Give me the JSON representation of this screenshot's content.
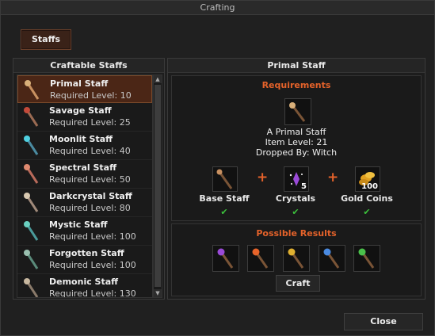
{
  "window": {
    "title": "Crafting"
  },
  "tab": {
    "label": "Staffs"
  },
  "list": {
    "header": "Craftable Staffs",
    "items": [
      {
        "name": "Primal Staff",
        "level": "Required Level: 10",
        "selected": true,
        "color": "#c89060",
        "gem": "#d9b07a"
      },
      {
        "name": "Savage Staff",
        "level": "Required Level: 25",
        "color": "#9a6a52",
        "gem": "#c44a3a"
      },
      {
        "name": "Moonlit Staff",
        "level": "Required Level: 40",
        "color": "#4a8aa0",
        "gem": "#4fd0e0"
      },
      {
        "name": "Spectral Staff",
        "level": "Required Level: 50",
        "color": "#b86a5a",
        "gem": "#e08a70"
      },
      {
        "name": "Darkcrystal Staff",
        "level": "Required Level: 80",
        "color": "#a08a7a",
        "gem": "#d8c8b0"
      },
      {
        "name": "Mystic Staff",
        "level": "Required Level: 100",
        "color": "#4a9a9a",
        "gem": "#6ad0c0"
      },
      {
        "name": "Forgotten Staff",
        "level": "Required Level: 100",
        "color": "#5a8a7a",
        "gem": "#9ac0b0"
      },
      {
        "name": "Demonic Staff",
        "level": "Required Level: 130",
        "color": "#8a7a6a",
        "gem": "#c8b8a0"
      }
    ]
  },
  "detail": {
    "header": "Primal Staff",
    "requirements_title": "Requirements",
    "item_name": "A Primal Staff",
    "item_level": "Item Level: 21",
    "dropped_by": "Dropped By: Witch",
    "components": [
      {
        "label": "Base Staff",
        "qty": "",
        "icon": "base-staff-icon"
      },
      {
        "label": "Crystals",
        "qty": "5",
        "icon": "crystals-icon"
      },
      {
        "label": "Gold Coins",
        "qty": "100",
        "icon": "gold-coins-icon"
      }
    ],
    "results_title": "Possible Results",
    "results": [
      {
        "icon": "purple-staff-icon",
        "gem": "#9a4ad8"
      },
      {
        "icon": "fire-staff-icon",
        "gem": "#e8642a"
      },
      {
        "icon": "golden-staff-icon",
        "gem": "#e0b030"
      },
      {
        "icon": "ice-staff-icon",
        "gem": "#4a8ae0"
      },
      {
        "icon": "nature-staff-icon",
        "gem": "#4ac04a"
      }
    ],
    "craft_label": "Craft"
  },
  "close_label": "Close",
  "colors": {
    "accent": "#e4622a",
    "check": "#3cc23c",
    "selected_bg": "#4b2616"
  }
}
